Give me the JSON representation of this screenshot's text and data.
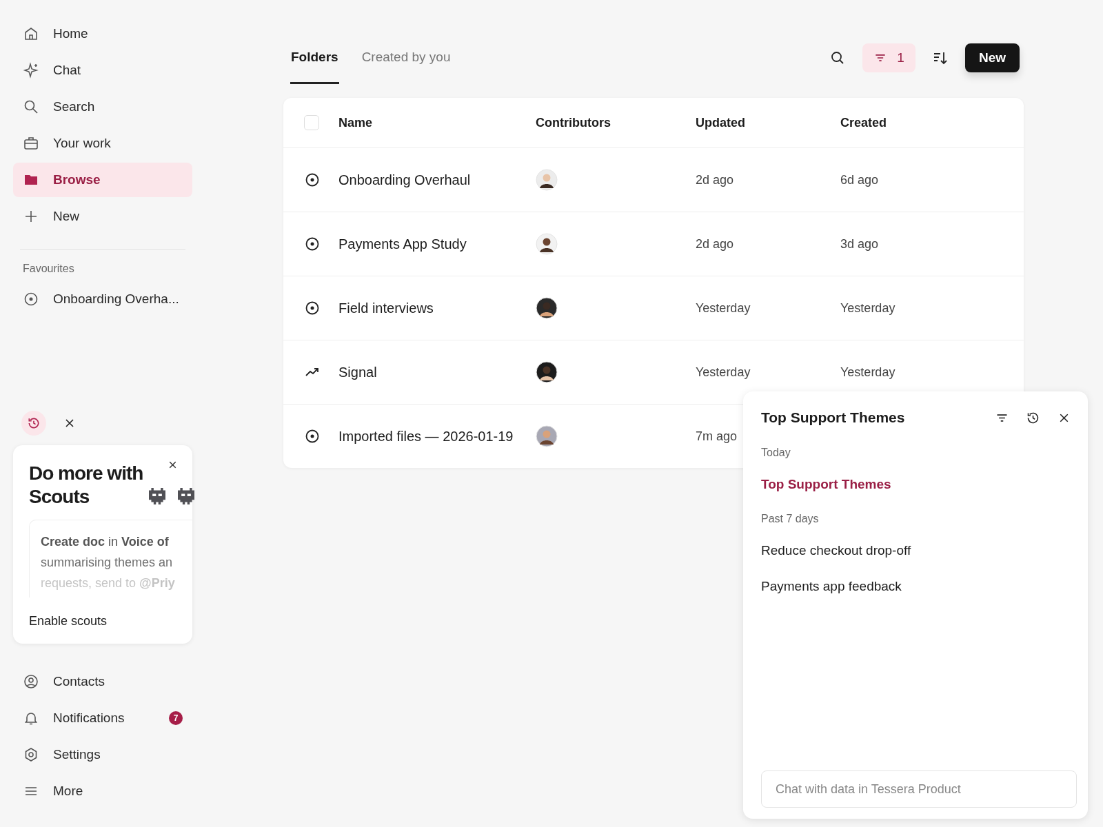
{
  "sidebar": {
    "nav": [
      {
        "label": "Home",
        "selected": false
      },
      {
        "label": "Chat",
        "selected": false
      },
      {
        "label": "Search",
        "selected": false
      },
      {
        "label": "Your work",
        "selected": false
      },
      {
        "label": "Browse",
        "selected": true
      },
      {
        "label": "New",
        "selected": false
      }
    ],
    "favourites_heading": "Favourites",
    "favourites": [
      {
        "label": "Onboarding Overha..."
      }
    ],
    "scouts_card": {
      "title": "Do more with Scouts",
      "lines": [
        "**Create doc** in **Voice of**",
        "summarising themes an",
        "requests, send to **@Priy**"
      ],
      "button": "Enable scouts"
    },
    "bottom_nav": [
      {
        "label": "Contacts"
      },
      {
        "label": "Notifications",
        "badge": "7"
      },
      {
        "label": "Settings"
      },
      {
        "label": "More"
      }
    ]
  },
  "tabs": [
    {
      "label": "Folders",
      "selected": true
    },
    {
      "label": "Created by you",
      "selected": false
    }
  ],
  "toolbar": {
    "filter_count": "1",
    "new_button": "New"
  },
  "table": {
    "select_all": {
      "checked": false
    },
    "columns": [
      "Name",
      "Contributors",
      "Updated",
      "Created"
    ],
    "rows": [
      {
        "kind": "folder",
        "name": "Onboarding Overhaul",
        "updated": "2d ago",
        "created": "6d ago"
      },
      {
        "kind": "folder",
        "name": "Payments App Study",
        "updated": "2d ago",
        "created": "3d ago"
      },
      {
        "kind": "folder",
        "name": "Field interviews",
        "updated": "Yesterday",
        "created": "Yesterday"
      },
      {
        "kind": "signal",
        "name": "Signal",
        "updated": "Yesterday",
        "created": "Yesterday"
      },
      {
        "kind": "folder",
        "name": "Imported files — 2026-01-19",
        "updated": "7m ago"
      }
    ]
  },
  "chat_panel": {
    "title": "Top Support Themes",
    "groups": [
      {
        "heading": "Today",
        "items": [
          {
            "label": "Top Support Themes",
            "selected": true
          }
        ]
      },
      {
        "heading": "Past 7 days",
        "items": [
          {
            "label": "Reduce checkout drop-off",
            "selected": false
          },
          {
            "label": "Payments app feedback",
            "selected": false
          }
        ]
      }
    ],
    "placeholder": "Chat with data in Tessera Product"
  }
}
